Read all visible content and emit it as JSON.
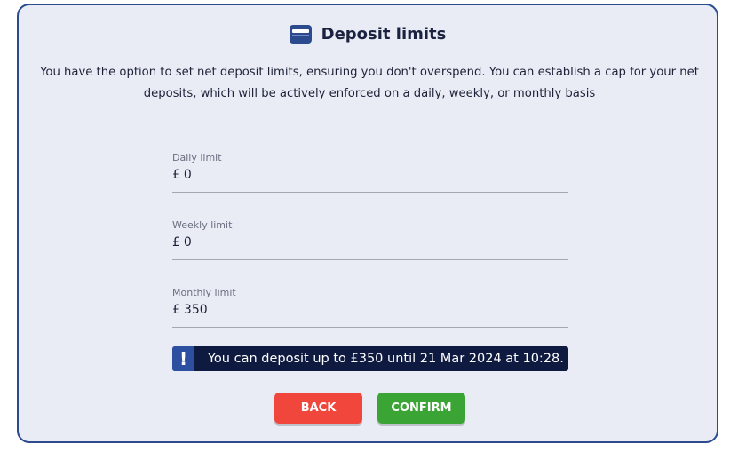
{
  "header": {
    "title": "Deposit limits"
  },
  "description": "You have the option to set net deposit limits, ensuring you don't overspend. You can establish a cap for your net deposits, which will be actively enforced on a daily, weekly, or monthly basis",
  "fields": [
    {
      "label": "Daily limit",
      "currency": "£",
      "value": "0"
    },
    {
      "label": "Weekly limit",
      "currency": "£",
      "value": "0"
    },
    {
      "label": "Monthly limit",
      "currency": "£",
      "value": "350"
    }
  ],
  "alert": {
    "icon": "!",
    "text": "You can deposit up to £350 until 21 Mar 2024 at 10:28."
  },
  "buttons": {
    "back_label": "BACK",
    "confirm_label": "CONFIRM"
  },
  "colors": {
    "border": "#2b4b8e",
    "panel_bg": "#e9ecf5",
    "alert_bg": "#0e1a40",
    "alert_icon_bg": "#2d4fa0",
    "back": "#f0463c",
    "confirm": "#3aa434"
  },
  "icons": {
    "header": "wallet-icon",
    "alert": "exclamation-icon"
  }
}
